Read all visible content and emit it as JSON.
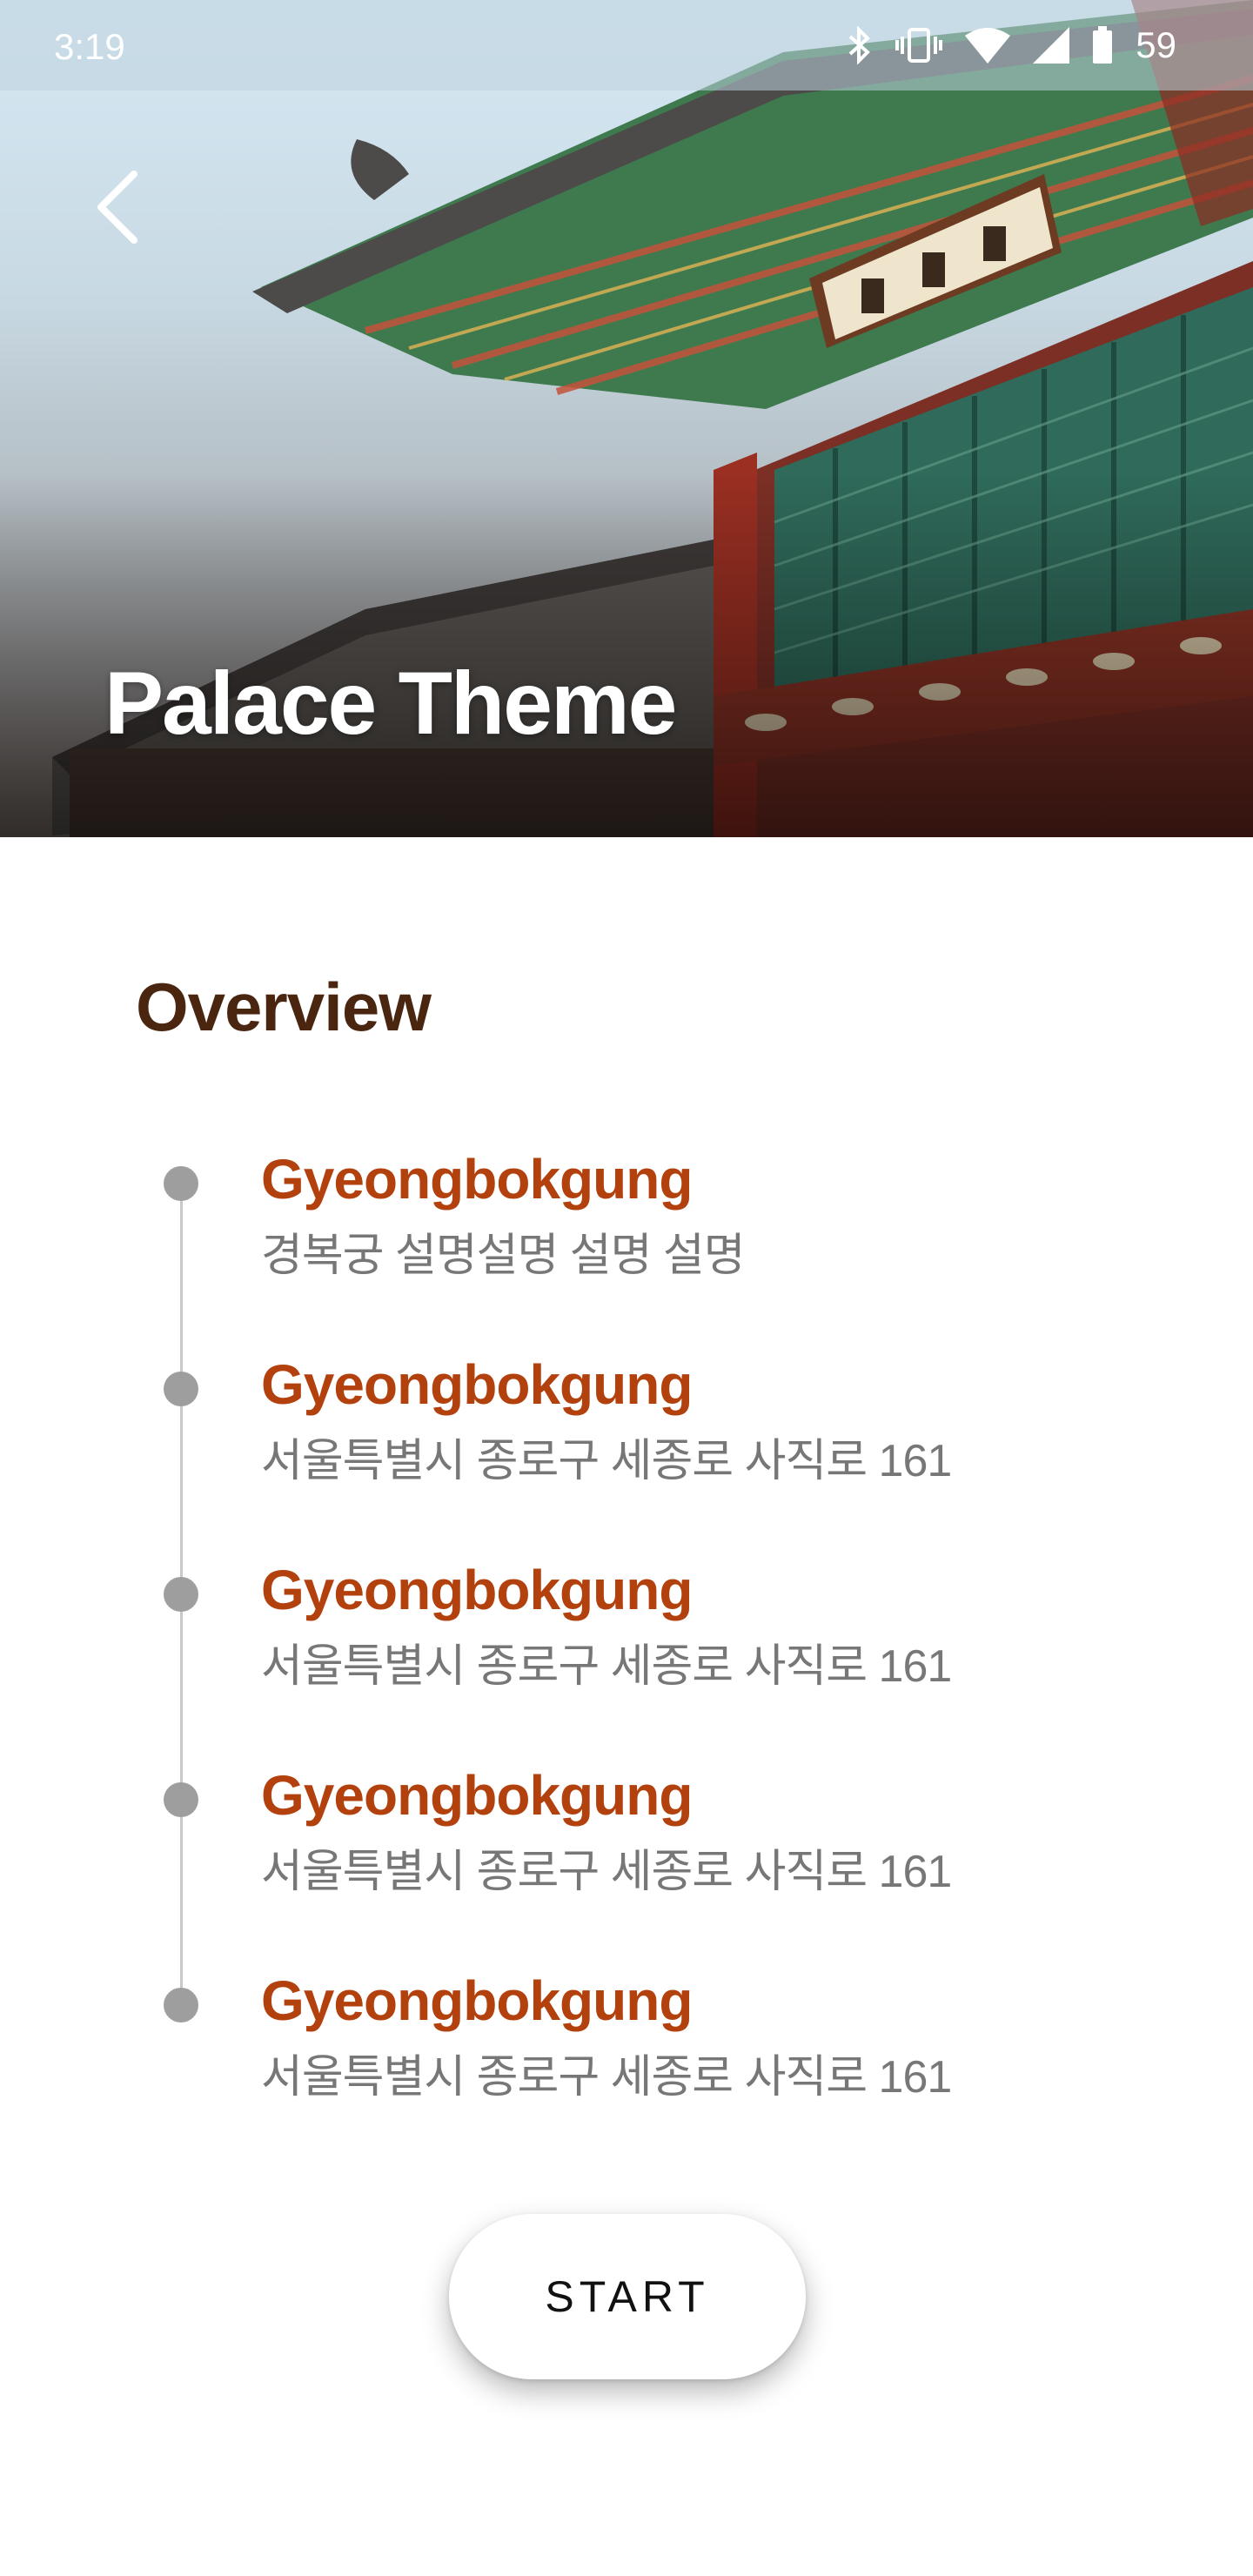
{
  "status_bar": {
    "time": "3:19",
    "battery": "59",
    "icons": [
      "bluetooth-icon",
      "vibrate-icon",
      "wifi-icon",
      "signal-icon",
      "battery-icon"
    ]
  },
  "header": {
    "title": "Palace Theme",
    "back_icon": "chevron-left-icon",
    "hero_image": "korean-palace-photo"
  },
  "overview": {
    "title": "Overview",
    "items": [
      {
        "name": "Gyeongbokgung",
        "description": "경복궁 설명설명 설명 설명"
      },
      {
        "name": "Gyeongbokgung",
        "description": "서울특별시 종로구 세종로 사직로 161"
      },
      {
        "name": "Gyeongbokgung",
        "description": "서울특별시 종로구 세종로 사직로 161"
      },
      {
        "name": "Gyeongbokgung",
        "description": "서울특별시 종로구 세종로 사직로 161"
      },
      {
        "name": "Gyeongbokgung",
        "description": "서울특별시 종로구 세종로 사직로 161"
      }
    ]
  },
  "actions": {
    "start_label": "START"
  },
  "colors": {
    "accent": "#b2410d",
    "heading": "#4a2510",
    "muted_text": "#777777",
    "timeline": "#9e9e9e"
  }
}
